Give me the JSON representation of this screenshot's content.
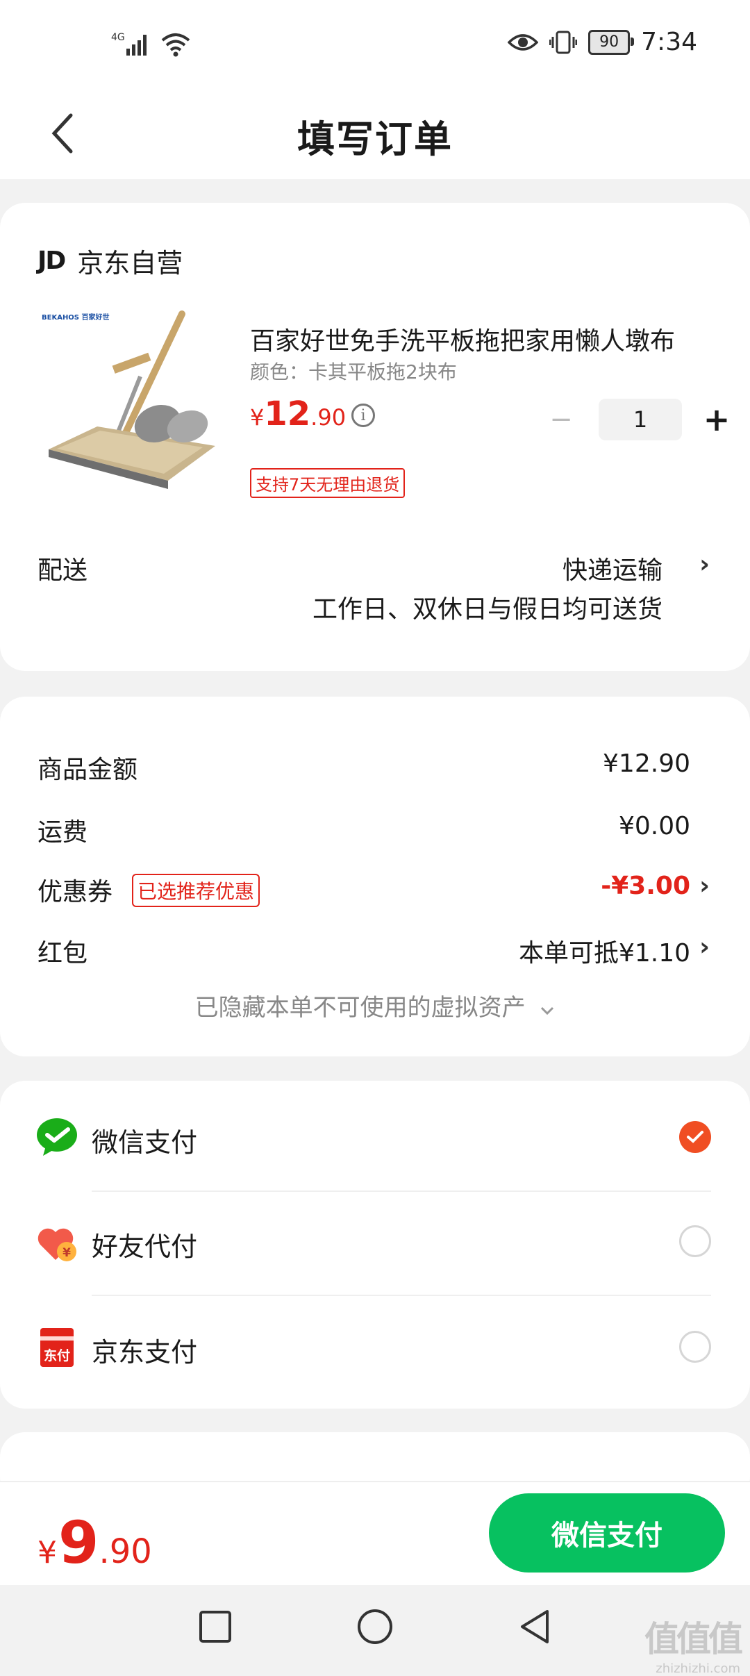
{
  "status_bar": {
    "network": "4G",
    "battery": "90",
    "time": "7:34"
  },
  "header": {
    "title": "填写订单"
  },
  "shop": {
    "logo": "JD",
    "name": "京东自营"
  },
  "product": {
    "title": "百家好世免手洗平板拖把家用懒人墩布",
    "spec": "颜色：卡其平板拖2块布",
    "price_currency": "¥",
    "price_int": "12",
    "price_dec": ".90",
    "quantity": "1",
    "return_policy": "支持7天无理由退货",
    "image_brand": "BEKAHOS 百家好世"
  },
  "delivery": {
    "label": "配送",
    "method": "快递运输",
    "note": "工作日、双休日与假日均可送货"
  },
  "summary": {
    "goods_label": "商品金额",
    "goods_value": "¥12.90",
    "shipping_label": "运费",
    "shipping_value": "¥0.00",
    "coupon_label": "优惠券",
    "coupon_badge": "已选推荐优惠",
    "coupon_value": "-¥3.00",
    "redpacket_label": "红包",
    "redpacket_value": "本单可抵¥1.10",
    "hidden_assets": "已隐藏本单不可使用的虚拟资产"
  },
  "payment": {
    "methods": [
      {
        "label": "微信支付",
        "icon": "wechat-pay-icon",
        "selected": true
      },
      {
        "label": "好友代付",
        "icon": "friend-pay-icon",
        "selected": false
      },
      {
        "label": "京东支付",
        "icon": "jd-pay-icon",
        "selected": false
      }
    ],
    "jd_pay_icon_text": "东付",
    "friend_pay_icon_text": "¥"
  },
  "footer": {
    "total_currency": "¥",
    "total_int": "9",
    "total_dec": ".90",
    "pay_button": "微信支付"
  },
  "watermark": {
    "mark": "值值值",
    "site": "zhizhizhi.com"
  },
  "colors": {
    "accent_red": "#e2231a",
    "wechat_green": "#07c160",
    "radio_selected": "#f04e23"
  }
}
